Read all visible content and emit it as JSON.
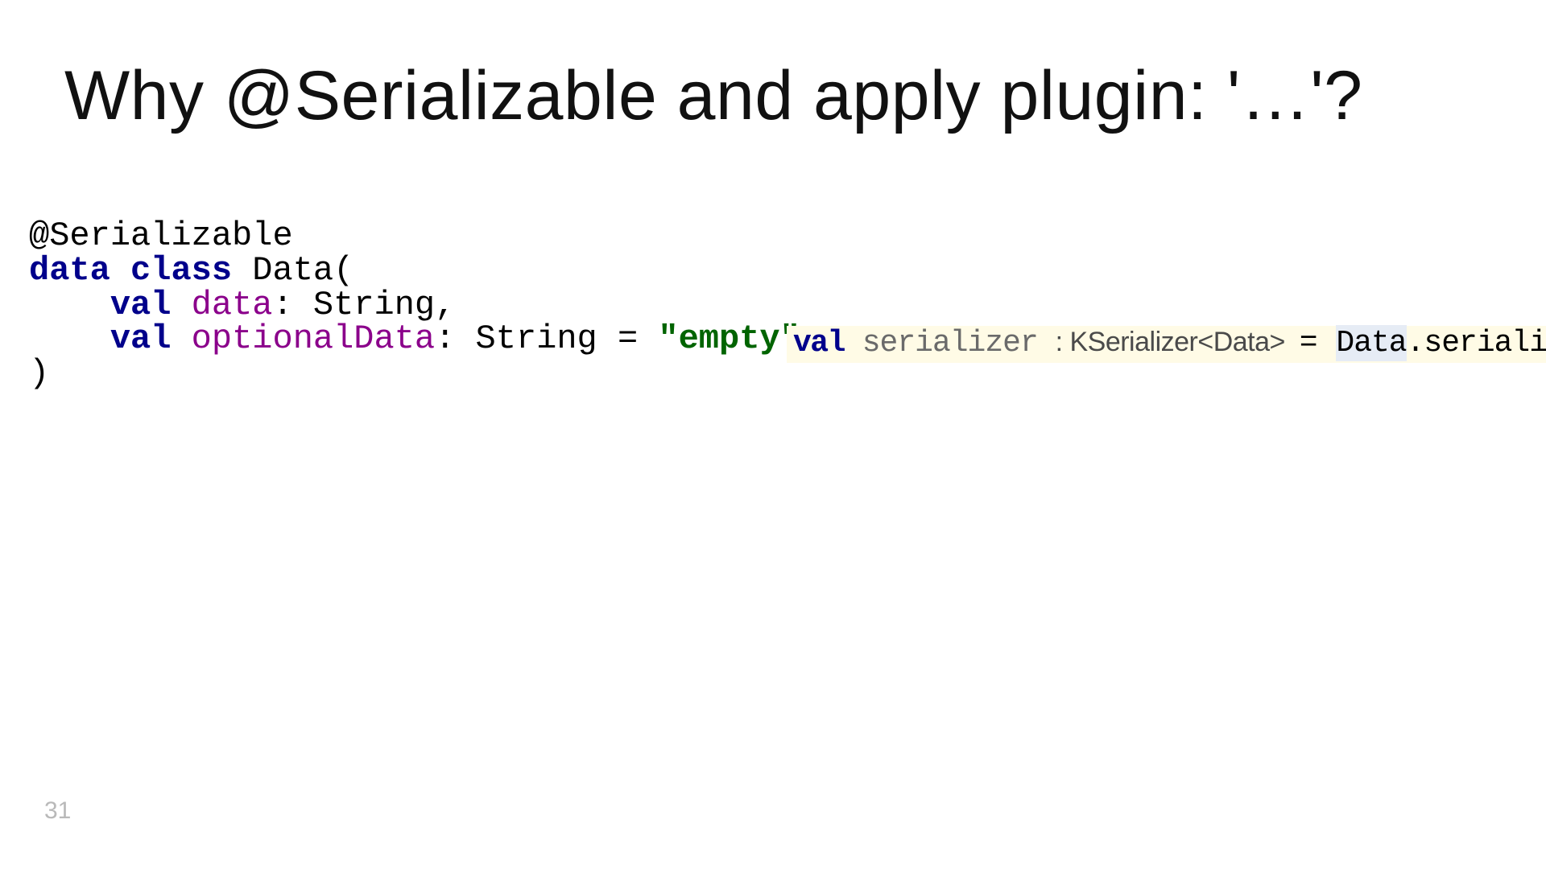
{
  "title": "Why @Serializable and apply plugin: '…'?",
  "code_left": {
    "l1_annotation": "@Serializable",
    "l2_kw1": "data",
    "l2_kw2": "class",
    "l2_name": "Data(",
    "l3_indent": "    ",
    "l3_kw": "val",
    "l3_prop": "data",
    "l3_rest": ": String,",
    "l4_indent": "    ",
    "l4_kw": "val",
    "l4_prop": "optionalData",
    "l4_mid": ": String = ",
    "l4_str": "\"empty\"",
    "l5_close": ")"
  },
  "code_right": {
    "kw": "val",
    "id": " serializer ",
    "type": ": KSerializer<Data>  ",
    "eq": "= ",
    "hl": "Data",
    "call": ".serializer()"
  },
  "page_number": "31"
}
